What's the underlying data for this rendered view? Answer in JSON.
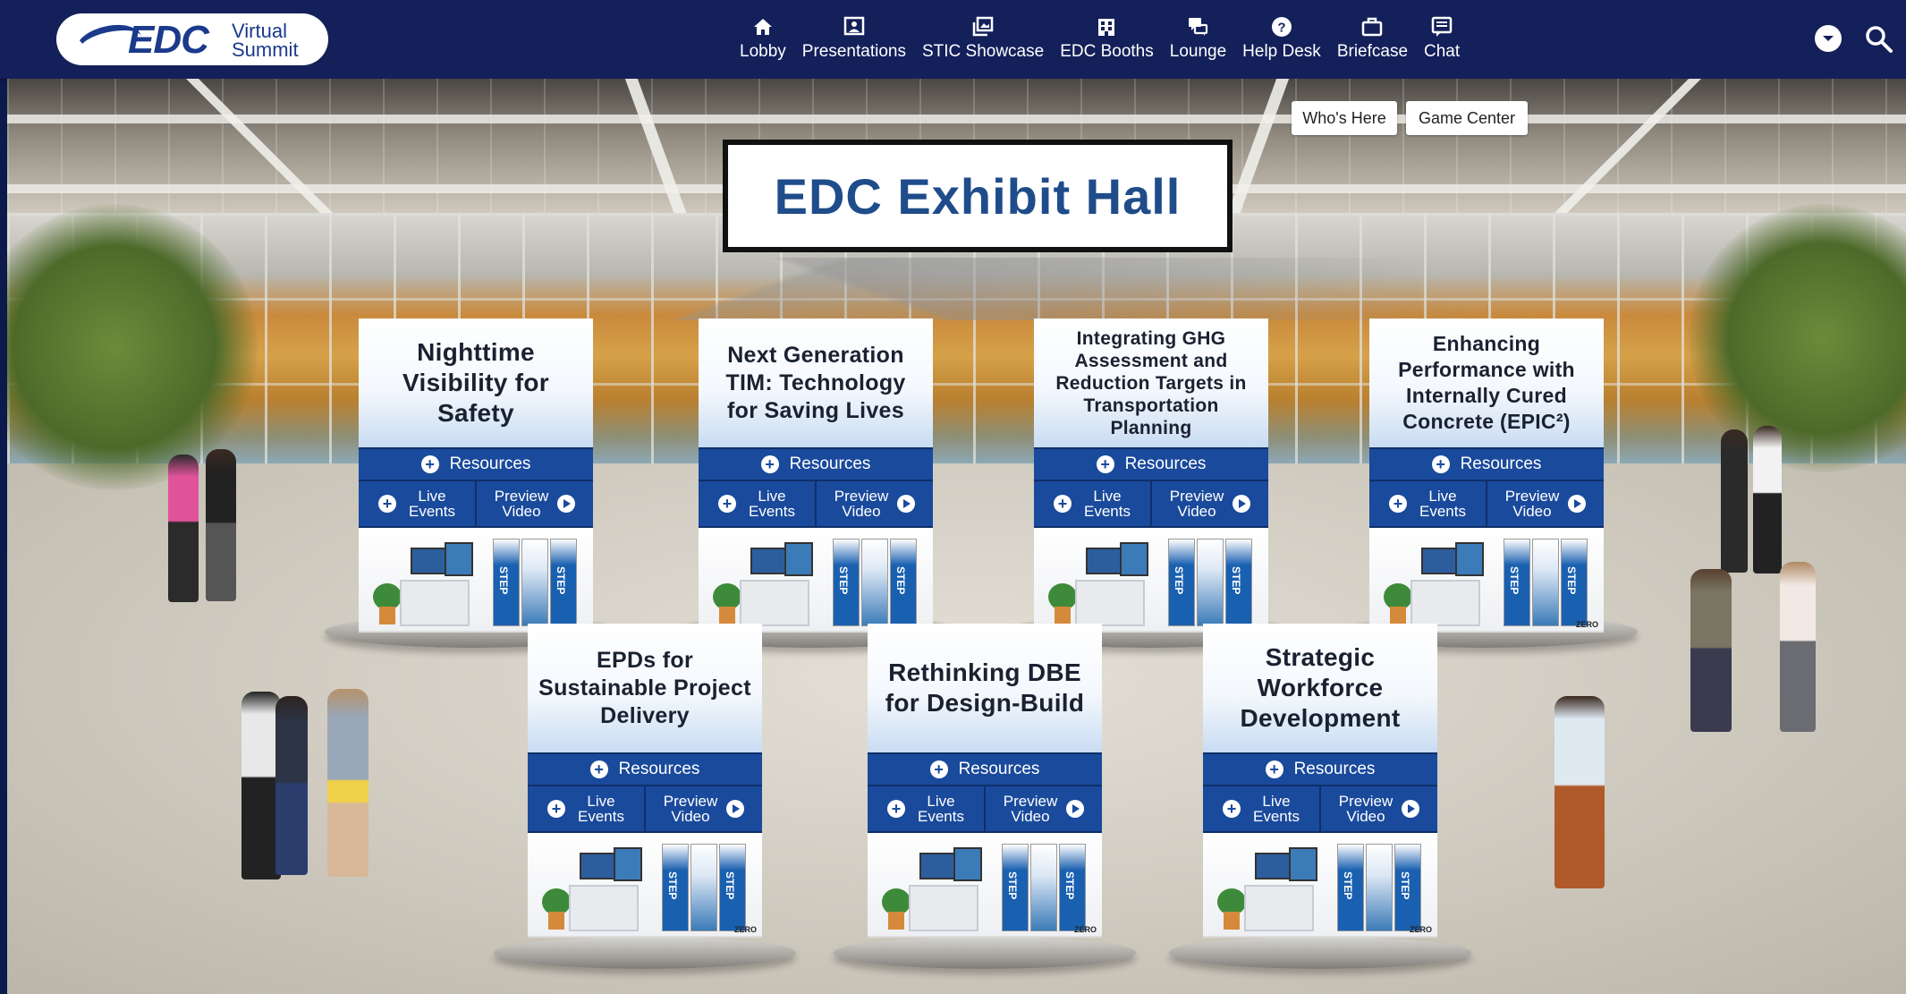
{
  "logo": {
    "brand": "EDC",
    "subtitle_line1": "Virtual",
    "subtitle_line2": "Summit"
  },
  "nav": [
    {
      "label": "Lobby",
      "icon": "home-icon"
    },
    {
      "label": "Presentations",
      "icon": "presentation-icon"
    },
    {
      "label": "STIC Showcase",
      "icon": "showcase-icon"
    },
    {
      "label": "EDC Booths",
      "icon": "booths-icon"
    },
    {
      "label": "Lounge",
      "icon": "lounge-chat-icon"
    },
    {
      "label": "Help Desk",
      "icon": "help-icon"
    },
    {
      "label": "Briefcase",
      "icon": "briefcase-icon"
    },
    {
      "label": "Chat",
      "icon": "chat-icon"
    }
  ],
  "hall": {
    "title": "EDC Exhibit Hall",
    "whos_here": "Who's Here",
    "game_center": "Game Center"
  },
  "booth_buttons": {
    "resources": "Resources",
    "live_1": "Live",
    "live_2": "Events",
    "preview_1": "Preview",
    "preview_2": "Video"
  },
  "booth_graphic": {
    "banner_text": "STEP",
    "brand": "ZERO"
  },
  "booths": [
    {
      "title": "Nighttime Visibility for Safety"
    },
    {
      "title": "Next Generation TIM: Technology for Saving Lives"
    },
    {
      "title": "Integrating GHG Assessment and Reduction Targets in Transportation Planning"
    },
    {
      "title": "Enhancing Performance with Internally Cured Concrete (EPIC²)"
    },
    {
      "title": "EPDs for Sustainable Project Delivery"
    },
    {
      "title": "Rethinking DBE for Design-Build"
    },
    {
      "title": "Strategic Workforce Development"
    }
  ],
  "colors": {
    "nav_bg": "#14205a",
    "booth_button_blue": "#1a4a9c",
    "hall_title": "#1f4c8a"
  }
}
